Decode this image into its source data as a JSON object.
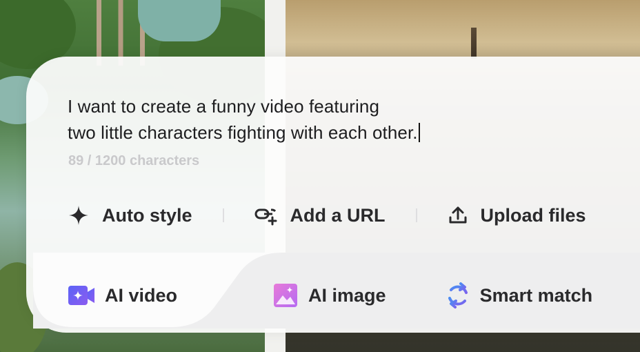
{
  "prompt": {
    "line1": "I want to create a funny video featuring",
    "line2": "two little characters fighting with each other.",
    "counter": "89 / 1200 characters"
  },
  "toolbar": {
    "auto_style": {
      "label": "Auto style",
      "icon": "sparkle-icon"
    },
    "add_url": {
      "label": "Add a URL",
      "icon": "link-plus-icon"
    },
    "upload": {
      "label": "Upload files",
      "icon": "upload-icon"
    }
  },
  "modes": {
    "ai_video": {
      "label": "AI video",
      "icon": "video-camera-icon",
      "color": "#6a5cf5",
      "selected": true
    },
    "ai_image": {
      "label": "AI image",
      "icon": "image-icon",
      "color": "#d56fd0"
    },
    "smart_match": {
      "label": "Smart match",
      "icon": "refresh-icon",
      "color": "#5d7df0"
    }
  }
}
